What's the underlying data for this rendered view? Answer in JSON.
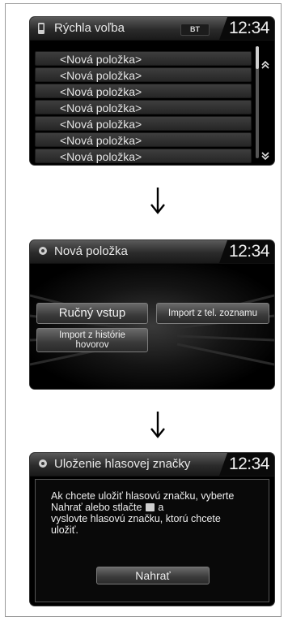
{
  "screen1": {
    "title": "Rýchla voľba",
    "badge": "BT",
    "clock": "12:34",
    "items": [
      "<Nová položka>",
      "<Nová položka>",
      "<Nová položka>",
      "<Nová položka>",
      "<Nová položka>",
      "<Nová položka>",
      "<Nová položka>"
    ],
    "icons": {
      "header": "phone-icon",
      "scroll_up": "chevron-up-icon",
      "scroll_down": "chevron-down-icon"
    }
  },
  "screen2": {
    "title": "Nová položka",
    "clock": "12:34",
    "buttons": {
      "manual": "Ručný vstup",
      "phonebook": "Import z tel. zoznamu",
      "history_line1": "Import z histórie",
      "history_line2": "hovorov"
    },
    "icons": {
      "header": "gear-icon"
    }
  },
  "screen3": {
    "title": "Uloženie hlasovej značky",
    "clock": "12:34",
    "message": {
      "line1": "Ak chcete uložiť hlasovú značku, vyberte",
      "line2a": "Nahrať alebo stlačte",
      "line2b": "a",
      "line3": "vyslovte hlasovú značku, ktorú chcete",
      "line4": "uložiť."
    },
    "record_button": "Nahrať",
    "icons": {
      "header": "gear-icon",
      "inline": "talk-button-icon"
    }
  }
}
